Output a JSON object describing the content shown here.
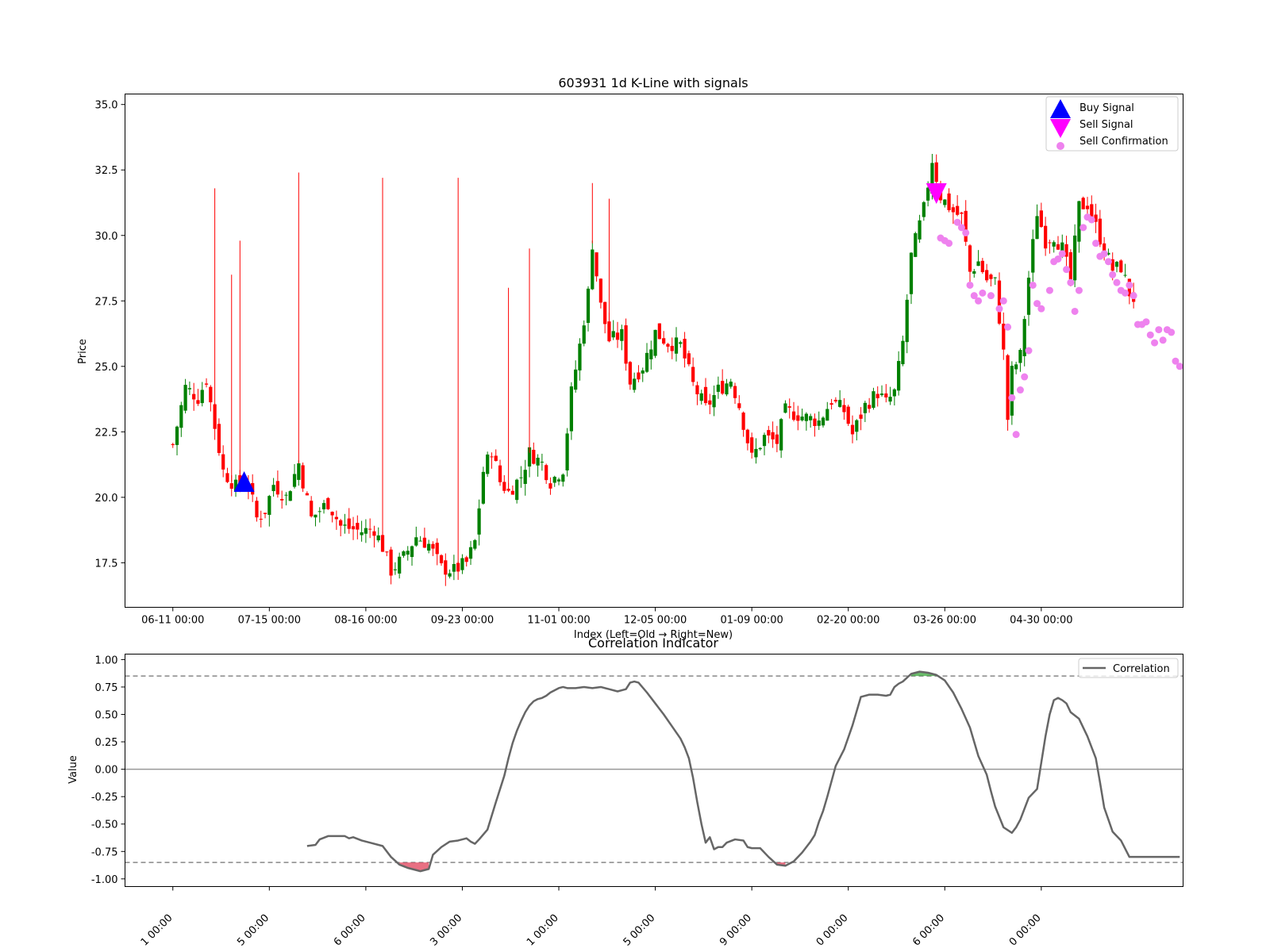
{
  "chart_data": [
    {
      "type": "candlestick",
      "title": "603931 1d K-Line with signals",
      "xlabel": "Index (Left=Old → Right=New)",
      "ylabel": "Price",
      "ylim": [
        15.8,
        35.4
      ],
      "yticks": [
        17.5,
        20.0,
        22.5,
        25.0,
        27.5,
        30.0,
        32.5,
        35.0
      ],
      "xticks": [
        {
          "index": 0,
          "label": "06-11 00:00"
        },
        {
          "index": 23,
          "label": "07-15 00:00"
        },
        {
          "index": 46,
          "label": "08-16 00:00"
        },
        {
          "index": 69,
          "label": "09-23 00:00"
        },
        {
          "index": 92,
          "label": "11-01 00:00"
        },
        {
          "index": 115,
          "label": "12-05 00:00"
        },
        {
          "index": 138,
          "label": "01-09 00:00"
        },
        {
          "index": 161,
          "label": "02-20 00:00"
        },
        {
          "index": 184,
          "label": "03-26 00:00"
        },
        {
          "index": 207,
          "label": "04-30 00:00"
        }
      ],
      "xlim": [
        -11.4,
        240.8
      ],
      "colors": {
        "up": "#008000",
        "down": "#ff0000",
        "buy": "#0000ff",
        "sell": "#ff00ff",
        "confirm": "#ee82ee"
      },
      "grid": false,
      "legend_position": "upper right",
      "legend": [
        {
          "label": "Buy Signal",
          "marker": "triangle-up",
          "color": "#0000ff"
        },
        {
          "label": "Sell Signal",
          "marker": "triangle-down",
          "color": "#ff00ff"
        },
        {
          "label": "Sell Confirmation",
          "marker": "circle",
          "color": "#ee82ee"
        }
      ],
      "candle_count": 230,
      "price_anchors": [
        [
          0,
          22.0
        ],
        [
          3,
          24.2
        ],
        [
          6,
          23.8
        ],
        [
          8,
          24.5
        ],
        [
          10,
          22.7
        ],
        [
          12,
          21.0
        ],
        [
          15,
          20.4
        ],
        [
          18,
          20.5
        ],
        [
          20,
          19.2
        ],
        [
          22,
          19.5
        ],
        [
          24,
          20.5
        ],
        [
          27,
          20.0
        ],
        [
          30,
          21.3
        ],
        [
          33,
          19.2
        ],
        [
          35,
          19.5
        ],
        [
          37,
          19.8
        ],
        [
          40,
          18.9
        ],
        [
          45,
          18.7
        ],
        [
          48,
          18.8
        ],
        [
          50,
          18.1
        ],
        [
          52,
          17.2
        ],
        [
          55,
          17.7
        ],
        [
          58,
          18.5
        ],
        [
          61,
          18.2
        ],
        [
          64,
          17.3
        ],
        [
          67,
          17.2
        ],
        [
          70,
          17.5
        ],
        [
          72,
          18.3
        ],
        [
          74,
          21.0
        ],
        [
          76,
          21.8
        ],
        [
          78,
          20.6
        ],
        [
          80,
          20.2
        ],
        [
          83,
          20.8
        ],
        [
          85,
          21.7
        ],
        [
          88,
          21.3
        ],
        [
          90,
          20.6
        ],
        [
          93,
          21.1
        ],
        [
          95,
          24.0
        ],
        [
          97,
          25.8
        ],
        [
          99,
          27.8
        ],
        [
          100,
          29.7
        ],
        [
          102,
          27.3
        ],
        [
          104,
          26.0
        ],
        [
          107,
          26.2
        ],
        [
          109,
          24.4
        ],
        [
          112,
          25.0
        ],
        [
          115,
          26.3
        ],
        [
          118,
          25.9
        ],
        [
          121,
          25.8
        ],
        [
          124,
          24.3
        ],
        [
          127,
          23.4
        ],
        [
          130,
          24.1
        ],
        [
          133,
          24.5
        ],
        [
          135,
          23.5
        ],
        [
          138,
          21.5
        ],
        [
          141,
          22.3
        ],
        [
          144,
          22.1
        ],
        [
          146,
          23.3
        ],
        [
          150,
          23.1
        ],
        [
          154,
          22.9
        ],
        [
          157,
          23.7
        ],
        [
          160,
          23.3
        ],
        [
          162,
          22.4
        ],
        [
          165,
          23.5
        ],
        [
          168,
          24.0
        ],
        [
          170,
          23.6
        ],
        [
          172,
          24.0
        ],
        [
          174,
          25.9
        ],
        [
          176,
          29.2
        ],
        [
          179,
          31.0
        ],
        [
          181,
          32.9
        ],
        [
          183,
          31.5
        ],
        [
          186,
          30.9
        ],
        [
          188,
          30.7
        ],
        [
          190,
          28.6
        ],
        [
          192,
          29.0
        ],
        [
          194,
          28.3
        ],
        [
          196,
          28.2
        ],
        [
          198,
          25.5
        ],
        [
          199,
          23.0
        ],
        [
          200,
          24.8
        ],
        [
          202,
          25.4
        ],
        [
          204,
          28.4
        ],
        [
          206,
          30.9
        ],
        [
          208,
          29.8
        ],
        [
          210,
          30.0
        ],
        [
          212,
          29.5
        ],
        [
          214,
          28.3
        ],
        [
          216,
          31.1
        ],
        [
          218,
          31.2
        ],
        [
          221,
          29.9
        ],
        [
          224,
          28.7
        ],
        [
          226,
          28.8
        ],
        [
          228,
          27.8
        ],
        [
          230,
          27.4
        ],
        [
          232,
          27.0
        ],
        [
          234,
          27.1
        ],
        [
          236,
          27.2
        ],
        [
          237,
          26.3
        ],
        [
          239,
          25.9
        ]
      ],
      "candles": [
        [
          10,
          31.8
        ],
        [
          14,
          28.5
        ],
        [
          16,
          29.8
        ],
        [
          30,
          32.4
        ],
        [
          50,
          32.2
        ],
        [
          68,
          32.2
        ],
        [
          80,
          28.0
        ],
        [
          85,
          29.5
        ],
        [
          100,
          32.0
        ],
        [
          104,
          31.4
        ]
      ],
      "buy_signals": [
        [
          17,
          20.6
        ]
      ],
      "sell_signals": [
        [
          182,
          31.6
        ]
      ],
      "sell_confirmations": [
        [
          183,
          29.9
        ],
        [
          184,
          29.8
        ],
        [
          185,
          29.7
        ],
        [
          187,
          30.5
        ],
        [
          188,
          30.3
        ],
        [
          189,
          30.1
        ],
        [
          190,
          28.1
        ],
        [
          191,
          27.7
        ],
        [
          192,
          27.5
        ],
        [
          193,
          27.8
        ],
        [
          195,
          27.7
        ],
        [
          197,
          27.2
        ],
        [
          198,
          27.5
        ],
        [
          199,
          26.5
        ],
        [
          200,
          23.8
        ],
        [
          201,
          22.4
        ],
        [
          202,
          24.1
        ],
        [
          203,
          24.6
        ],
        [
          204,
          25.6
        ],
        [
          205,
          28.1
        ],
        [
          206,
          27.4
        ],
        [
          207,
          27.2
        ],
        [
          209,
          27.9
        ],
        [
          210,
          29.0
        ],
        [
          211,
          29.1
        ],
        [
          212,
          29.3
        ],
        [
          213,
          28.7
        ],
        [
          214,
          28.2
        ],
        [
          215,
          27.1
        ],
        [
          216,
          27.9
        ],
        [
          217,
          30.3
        ],
        [
          218,
          30.7
        ],
        [
          219,
          30.6
        ],
        [
          220,
          29.7
        ],
        [
          221,
          29.2
        ],
        [
          222,
          29.3
        ],
        [
          223,
          29.0
        ],
        [
          224,
          28.5
        ],
        [
          225,
          28.2
        ],
        [
          226,
          27.9
        ],
        [
          227,
          27.8
        ],
        [
          228,
          28.1
        ],
        [
          229,
          27.7
        ],
        [
          230,
          26.6
        ],
        [
          231,
          26.6
        ],
        [
          232,
          26.7
        ],
        [
          233,
          26.2
        ],
        [
          234,
          25.9
        ],
        [
          235,
          26.4
        ],
        [
          236,
          26.0
        ],
        [
          237,
          26.4
        ],
        [
          238,
          26.3
        ],
        [
          239,
          25.2
        ],
        [
          240,
          25.0
        ]
      ]
    },
    {
      "type": "line",
      "title": "Correlation Indicator",
      "xlabel": "",
      "ylabel": "Value",
      "ylim": [
        -1.07,
        1.05
      ],
      "yticks": [
        -1.0,
        -0.75,
        -0.5,
        -0.25,
        0.0,
        0.25,
        0.5,
        0.75,
        1.0
      ],
      "upper_threshold": 0.85,
      "lower_threshold": -0.85,
      "xticks": [
        {
          "index": 0,
          "label": "1 00:00"
        },
        {
          "index": 23,
          "label": "5 00:00"
        },
        {
          "index": 46,
          "label": "6 00:00"
        },
        {
          "index": 69,
          "label": "3 00:00"
        },
        {
          "index": 92,
          "label": "1 00:00"
        },
        {
          "index": 115,
          "label": "5 00:00"
        },
        {
          "index": 138,
          "label": "9 00:00"
        },
        {
          "index": 161,
          "label": "0 00:00"
        },
        {
          "index": 184,
          "label": "6 00:00"
        },
        {
          "index": 207,
          "label": "0 00:00"
        }
      ],
      "xlim": [
        -11.4,
        240.8
      ],
      "grid": false,
      "legend_position": "upper right",
      "series": [
        {
          "name": "Correlation",
          "color": "#666666",
          "x": [
            32,
            34,
            35,
            37,
            39,
            41,
            42,
            43,
            45,
            47,
            50,
            52,
            54,
            56,
            58,
            59,
            60,
            61,
            62,
            64,
            66,
            68,
            70,
            71,
            72,
            73,
            75,
            77,
            79,
            80,
            81,
            82,
            83,
            84,
            85,
            86,
            87,
            88,
            89,
            90,
            91,
            92,
            93,
            94,
            96,
            98,
            100,
            102,
            104,
            106,
            108,
            109,
            110,
            111,
            113,
            115,
            117,
            119,
            121,
            122,
            123,
            124,
            125,
            126,
            127,
            128,
            129,
            130,
            131,
            132,
            134,
            136,
            137,
            138,
            139,
            140,
            142,
            144,
            146,
            148,
            150,
            151,
            152,
            153,
            154,
            155,
            156,
            157,
            158,
            160,
            162,
            164,
            166,
            168,
            170,
            171,
            172,
            173,
            174,
            176,
            178,
            180,
            182,
            184,
            186,
            188,
            190,
            192,
            194,
            195,
            196,
            198,
            200,
            201,
            202,
            204,
            206,
            207,
            208,
            209,
            210,
            211,
            212,
            213,
            214,
            216,
            218,
            220,
            221,
            222,
            224,
            226,
            228,
            230,
            232,
            234,
            236,
            238,
            240
          ],
          "y": [
            -0.7,
            -0.69,
            -0.64,
            -0.61,
            -0.61,
            -0.61,
            -0.63,
            -0.62,
            -0.65,
            -0.67,
            -0.7,
            -0.8,
            -0.87,
            -0.9,
            -0.92,
            -0.93,
            -0.92,
            -0.91,
            -0.78,
            -0.71,
            -0.66,
            -0.65,
            -0.63,
            -0.66,
            -0.68,
            -0.64,
            -0.55,
            -0.3,
            -0.06,
            0.1,
            0.24,
            0.35,
            0.44,
            0.52,
            0.58,
            0.62,
            0.64,
            0.65,
            0.67,
            0.7,
            0.72,
            0.74,
            0.75,
            0.74,
            0.74,
            0.75,
            0.74,
            0.75,
            0.73,
            0.71,
            0.73,
            0.79,
            0.8,
            0.79,
            0.7,
            0.6,
            0.5,
            0.39,
            0.28,
            0.2,
            0.1,
            -0.08,
            -0.3,
            -0.5,
            -0.67,
            -0.62,
            -0.73,
            -0.71,
            -0.71,
            -0.67,
            -0.64,
            -0.65,
            -0.71,
            -0.72,
            -0.72,
            -0.72,
            -0.8,
            -0.87,
            -0.88,
            -0.84,
            -0.76,
            -0.71,
            -0.66,
            -0.6,
            -0.48,
            -0.38,
            -0.25,
            -0.11,
            0.03,
            0.18,
            0.4,
            0.66,
            0.68,
            0.68,
            0.67,
            0.68,
            0.75,
            0.78,
            0.8,
            0.87,
            0.89,
            0.88,
            0.86,
            0.81,
            0.7,
            0.55,
            0.38,
            0.12,
            -0.05,
            -0.2,
            -0.34,
            -0.53,
            -0.58,
            -0.53,
            -0.46,
            -0.26,
            -0.18,
            0.06,
            0.3,
            0.5,
            0.63,
            0.65,
            0.63,
            0.6,
            0.52,
            0.46,
            0.3,
            0.1,
            -0.12,
            -0.35,
            -0.57,
            -0.65,
            -0.8,
            -0.8,
            -0.8,
            -0.8,
            -0.8,
            -0.8,
            -0.8
          ]
        }
      ]
    }
  ]
}
